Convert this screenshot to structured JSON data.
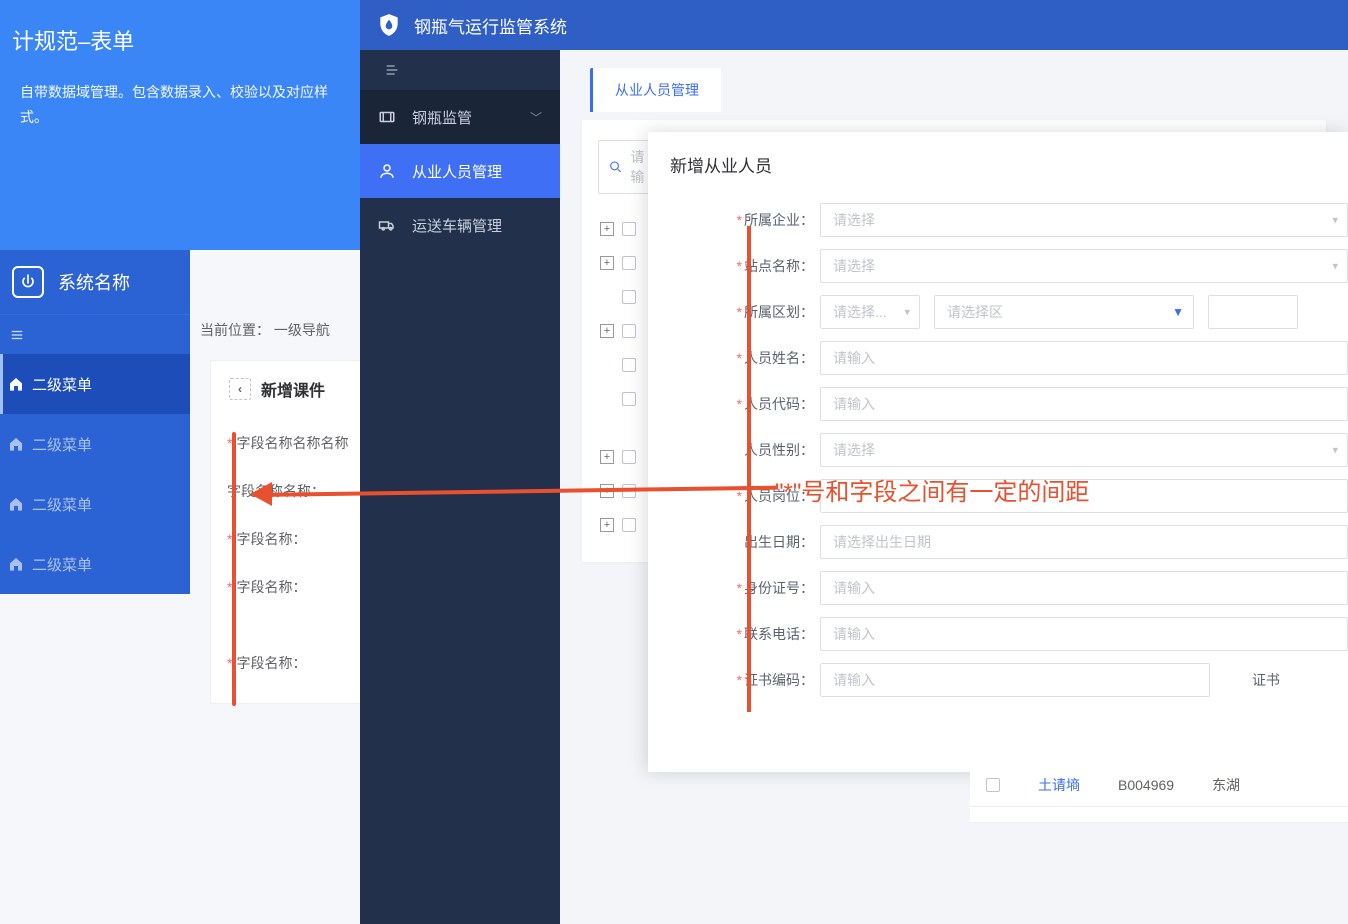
{
  "spec": {
    "title": "计规范–表单",
    "sub": "自带数据域管理。包含数据录入、校验以及对应样式。"
  },
  "sys": {
    "name": "系统名称",
    "menu": [
      "二级菜单",
      "二级菜单",
      "二级菜单",
      "二级菜单"
    ]
  },
  "breadcrumb_left": "当前位置： 一级导航",
  "card_left": {
    "title": "新增课件",
    "fields": [
      "字段名称名称名称",
      "字段名称名称：",
      "字段名称：",
      "字段名称：",
      "字段名称："
    ]
  },
  "app": {
    "title": "钢瓶气运行监管系统",
    "nav": [
      {
        "label": "钢瓶监管",
        "icon": "cylinder",
        "chevron": true
      },
      {
        "label": "从业人员管理",
        "icon": "person"
      },
      {
        "label": "运送车辆管理",
        "icon": "truck"
      }
    ],
    "tab": "从业人员管理",
    "search_ph": "请输"
  },
  "modal": {
    "title": "新增从业人员",
    "fields": {
      "company": {
        "label": "所属企业：",
        "ph": "请选择",
        "req": true,
        "type": "select"
      },
      "site": {
        "label": "站点名称：",
        "ph": "请选择",
        "req": true,
        "type": "select"
      },
      "area": {
        "label": "所属区划：",
        "ph1": "请选择...",
        "ph2": "请选择区",
        "req": true,
        "type": "area"
      },
      "name": {
        "label": "人员姓名：",
        "ph": "请输入",
        "req": true,
        "type": "input"
      },
      "code": {
        "label": "人员代码：",
        "ph": "请输入",
        "req": true,
        "type": "input"
      },
      "gender": {
        "label": "人员性别：",
        "ph": "请选择",
        "req": false,
        "type": "select"
      },
      "post": {
        "label": "人员岗位：",
        "ph": "",
        "req": true,
        "type": "input"
      },
      "birth": {
        "label": "出生日期：",
        "ph": "请选择出生日期",
        "req": false,
        "type": "date"
      },
      "idno": {
        "label": "身份证号：",
        "ph": "请输入",
        "req": true,
        "type": "input"
      },
      "phone": {
        "label": "联系电话：",
        "ph": "请输入",
        "req": true,
        "type": "input"
      },
      "cert": {
        "label": "证书编码：",
        "ph": "请输入",
        "cert_label": "证书",
        "req": true,
        "type": "cert"
      }
    }
  },
  "annotation": "\"*\"号和字段之间有一定的间距",
  "table_row": {
    "name": "土请墒",
    "code": "B004969",
    "region": "东湖"
  }
}
